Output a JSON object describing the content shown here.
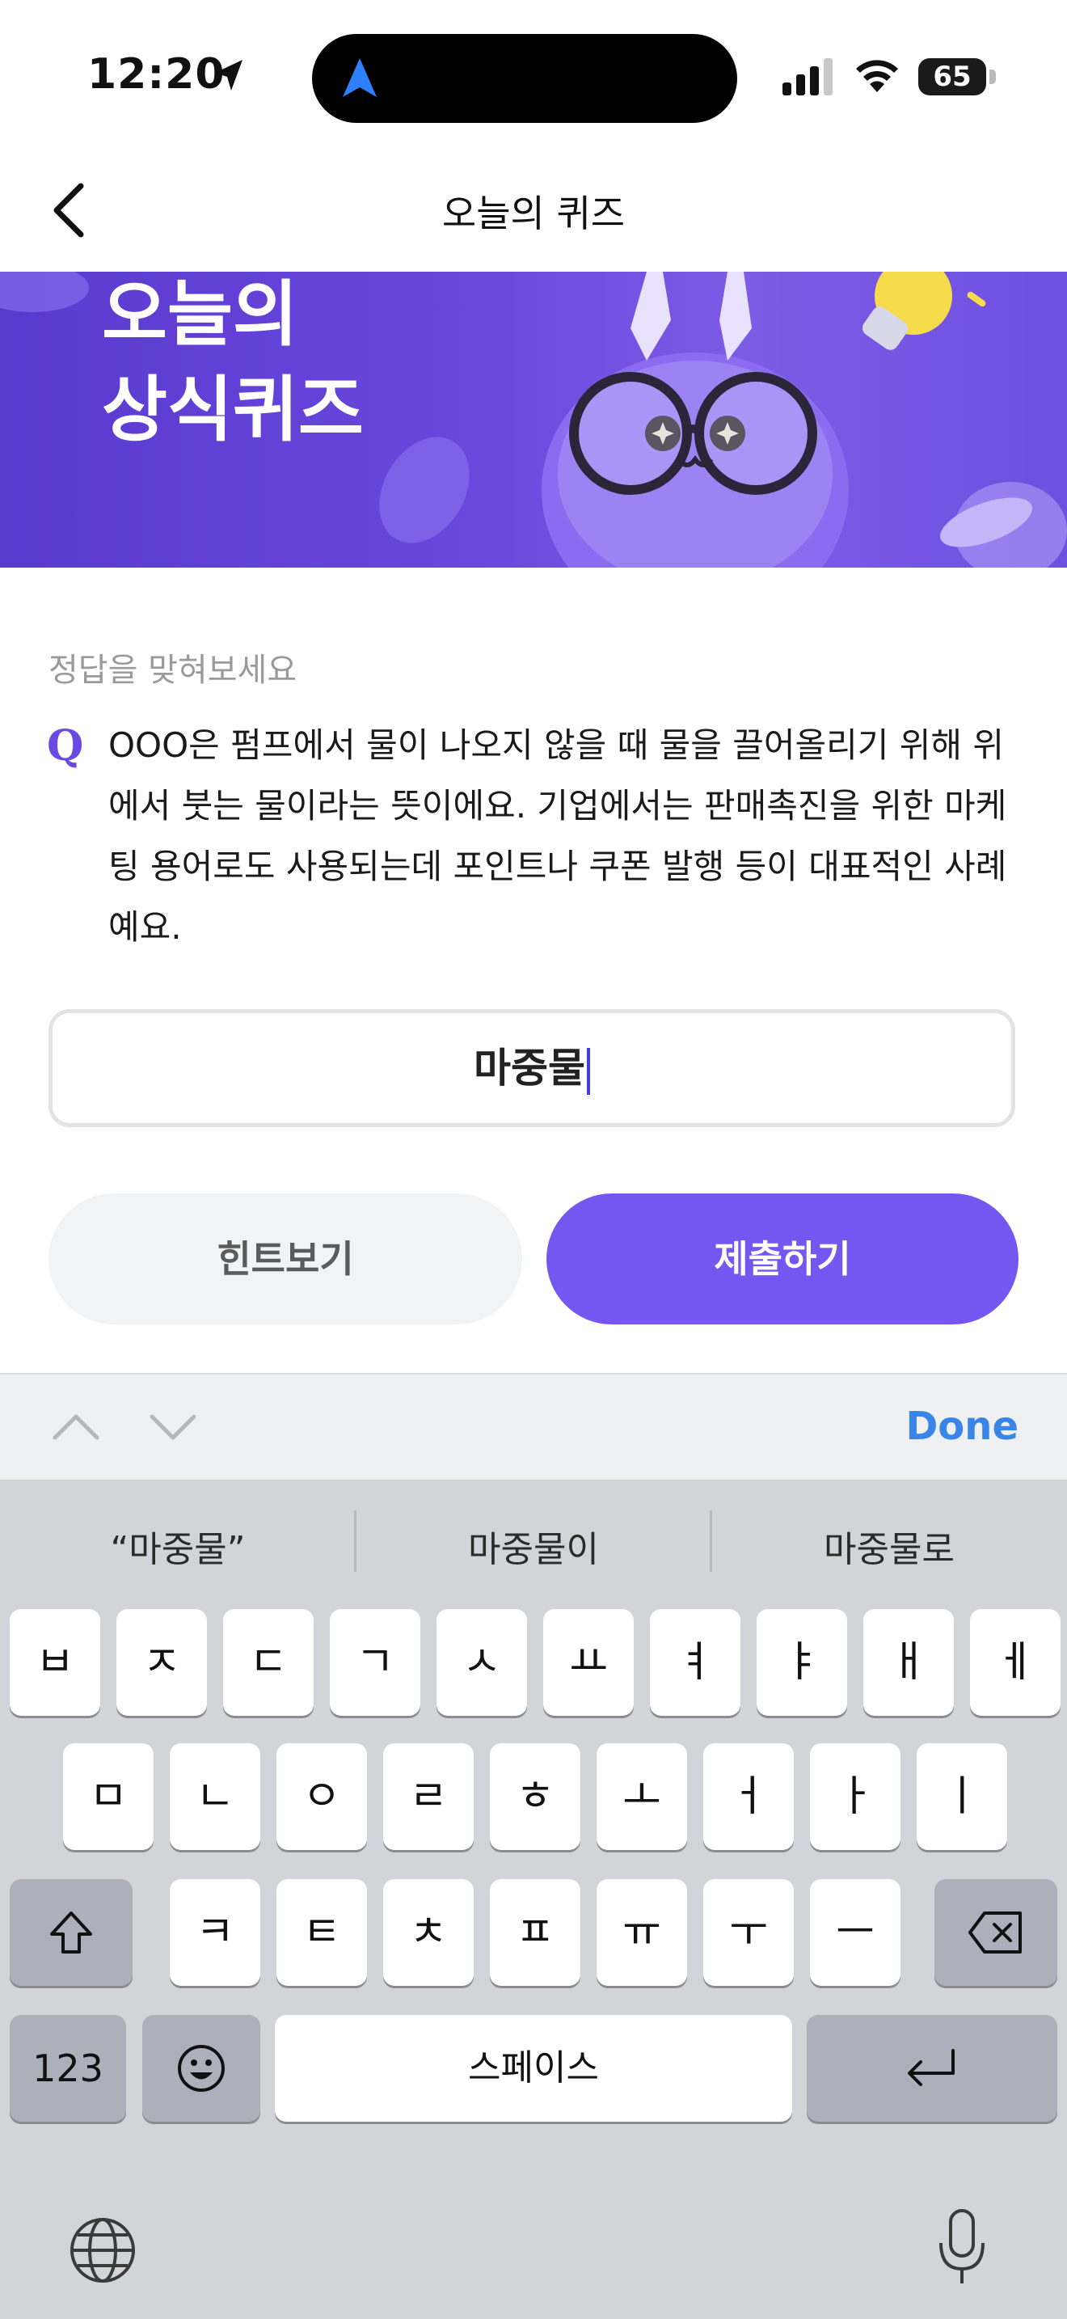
{
  "status_bar": {
    "time": "12:20",
    "battery": "65"
  },
  "header": {
    "title": "오늘의 퀴즈"
  },
  "banner": {
    "title": "오늘의\n상식퀴즈"
  },
  "quiz": {
    "instruction": "정답을 맞혀보세요",
    "q_label": "Q",
    "question": "OOO은 펌프에서 물이 나오지 않을 때 물을 끌어올리기 위해 위에서 붓는 물이라는 뜻이에요. 기업에서는 판매촉진을 위한 마케팅 용어로도 사용되는데 포인트나 쿠폰 발행 등이 대표적인 사례예요.",
    "answer": "마중물",
    "hint_label": "힌트보기",
    "submit_label": "제출하기"
  },
  "accessory": {
    "done_label": "Done"
  },
  "keyboard": {
    "suggestions": [
      "“마중물”",
      "마중물이",
      "마중물로"
    ],
    "row1": [
      "ㅂ",
      "ㅈ",
      "ㄷ",
      "ㄱ",
      "ㅅ",
      "ㅛ",
      "ㅕ",
      "ㅑ",
      "ㅐ",
      "ㅔ"
    ],
    "row2": [
      "ㅁ",
      "ㄴ",
      "ㅇ",
      "ㄹ",
      "ㅎ",
      "ㅗ",
      "ㅓ",
      "ㅏ",
      "ㅣ"
    ],
    "row3": [
      "ㅋ",
      "ㅌ",
      "ㅊ",
      "ㅍ",
      "ㅠ",
      "ㅜ",
      "ㅡ"
    ],
    "numbers_label": "123",
    "space_label": "스페이스"
  },
  "colors": {
    "accent": "#7456f0",
    "done": "#3a86e8",
    "banner": "#6a48de"
  },
  "icons": [
    "location-arrow-icon",
    "signal-icon",
    "wifi-icon",
    "battery-icon",
    "back-chevron-icon",
    "chevron-up-icon",
    "chevron-down-icon",
    "shift-icon",
    "delete-icon",
    "emoji-icon",
    "return-icon",
    "globe-icon",
    "microphone-icon"
  ]
}
